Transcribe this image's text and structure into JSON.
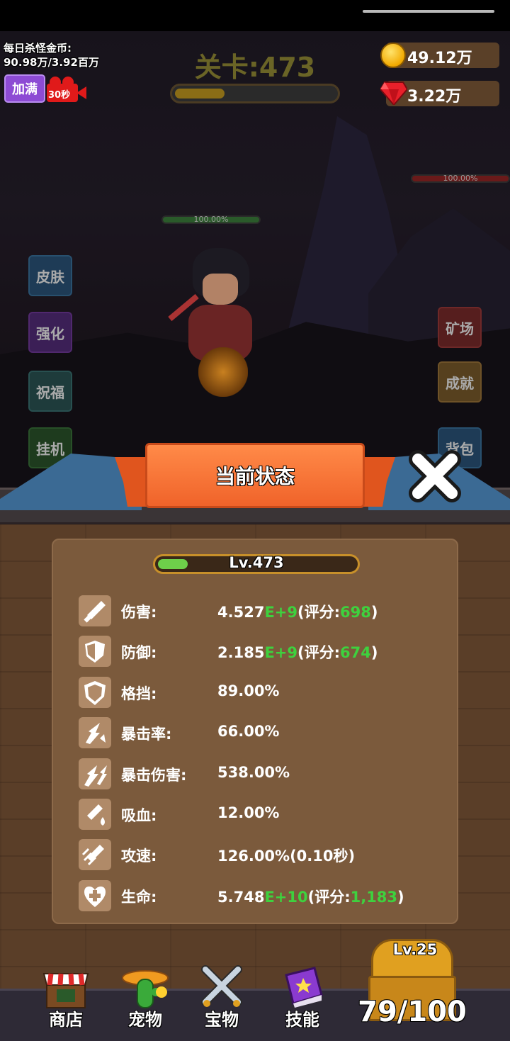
{
  "hud": {
    "daily_line1": "每日杀怪金币:",
    "daily_line2": "90.98万/3.92百万",
    "fill_button": "加满",
    "ad_timer": "30秒",
    "stage_title": "关卡:473",
    "gold": "49.12万",
    "gems": "3.22万"
  },
  "battle": {
    "hero_hp": "100.00%",
    "enemy_hp": "100.00%"
  },
  "side_menu": {
    "skin": "皮肤",
    "enhance": "强化",
    "bless": "祝福",
    "idle": "挂机",
    "mine": "矿场",
    "achievement": "成就",
    "bag": "背包"
  },
  "panel": {
    "title": "当前状态",
    "level": "Lv.473",
    "level_progress": 0.15,
    "stats": [
      {
        "label": "伤害:",
        "pre": "4.527",
        "exp": "E+9",
        "mid": "(评分:",
        "score": "698",
        "post": ")",
        "icon": "sword-icon"
      },
      {
        "label": "防御:",
        "pre": "2.185",
        "exp": "E+9",
        "mid": "(评分:",
        "score": "674",
        "post": ")",
        "icon": "shield-icon"
      },
      {
        "label": "格挡:",
        "pre": "89.00%",
        "icon": "block-shield-icon"
      },
      {
        "label": "暴击率:",
        "pre": "66.00%",
        "icon": "crit-burst-icon"
      },
      {
        "label": "暴击伤害:",
        "pre": "538.00%",
        "icon": "crit-damage-icon"
      },
      {
        "label": "吸血:",
        "pre": "12.00%",
        "icon": "lifesteal-icon"
      },
      {
        "label": "攻速:",
        "pre": "126.00%(0.10秒)",
        "icon": "attack-speed-icon"
      },
      {
        "label": "生命:",
        "pre": "5.748",
        "exp": "E+10",
        "mid": "(评分:",
        "score": "1,183",
        "post": ")",
        "icon": "heart-icon"
      }
    ]
  },
  "nav": {
    "shop": "商店",
    "pet": "宠物",
    "treasure": "宝物",
    "skill": "技能"
  },
  "chest": {
    "level": "Lv.25",
    "count": "79/100"
  }
}
